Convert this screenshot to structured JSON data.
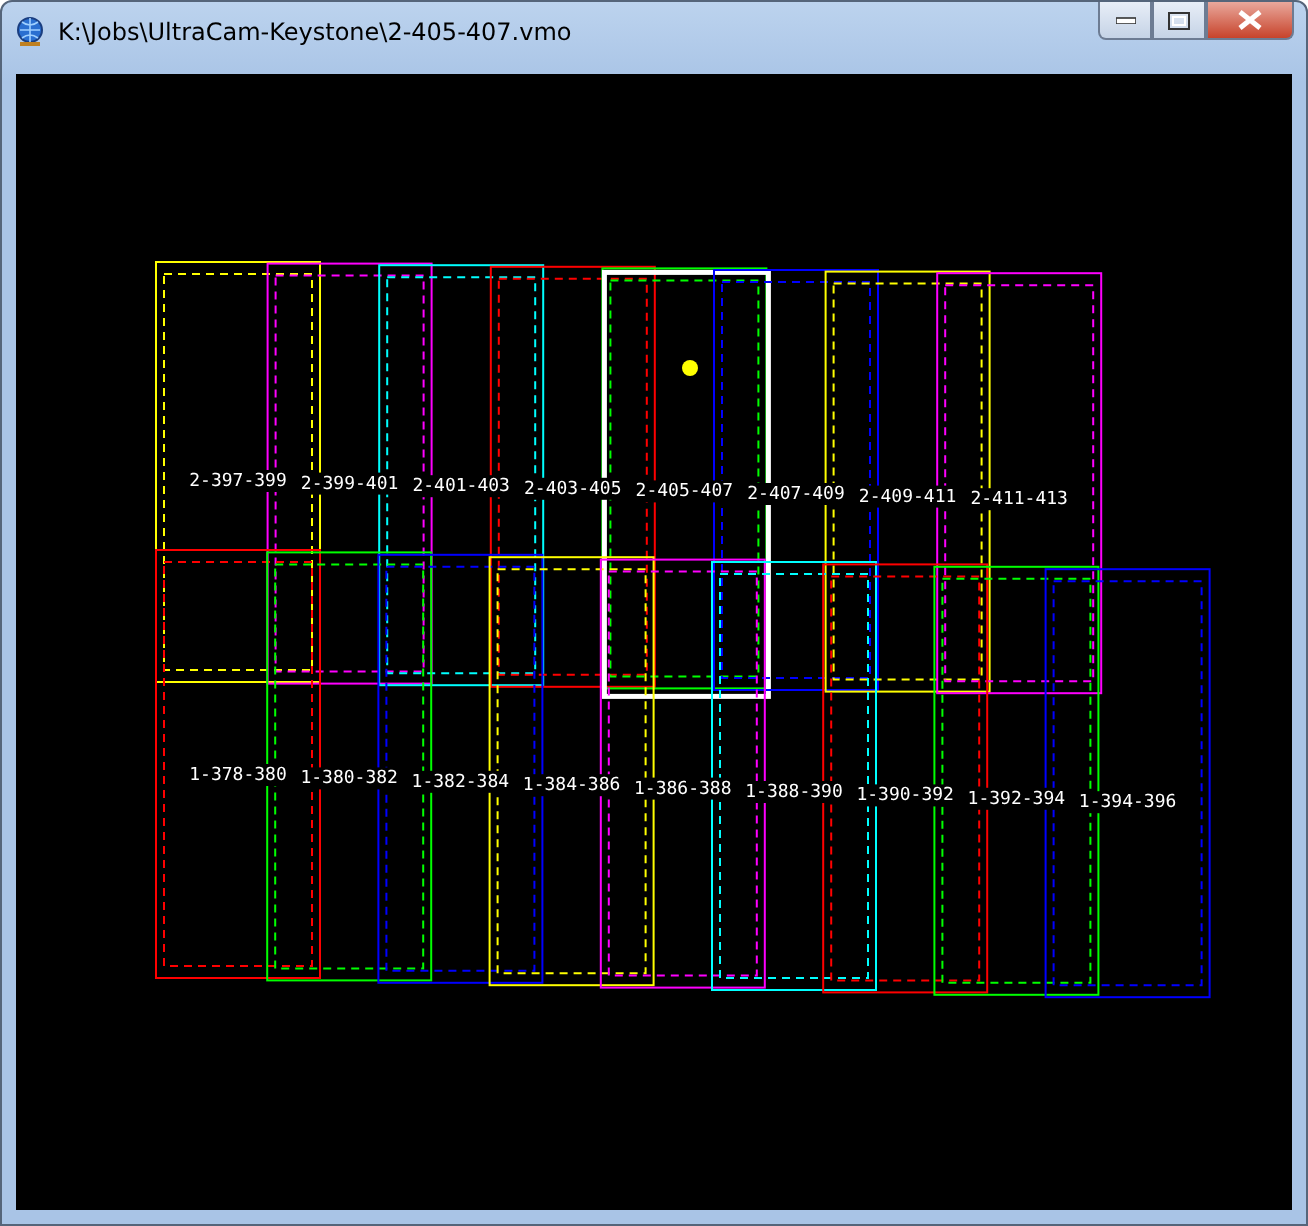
{
  "window": {
    "title": "K:\\Jobs\\UltraCam-Keystone\\2-405-407.vmo"
  },
  "strips": [
    {
      "frames": [
        {
          "label": "2-397-399",
          "color": "#ffff00",
          "selected": false
        },
        {
          "label": "2-399-401",
          "color": "#ff00ff",
          "selected": false
        },
        {
          "label": "2-401-403",
          "color": "#00ffff",
          "selected": false
        },
        {
          "label": "2-403-405",
          "color": "#ff0000",
          "selected": false
        },
        {
          "label": "2-405-407",
          "color": "#00ff00",
          "selected": true
        },
        {
          "label": "2-407-409",
          "color": "#0000ff",
          "selected": false
        },
        {
          "label": "2-409-411",
          "color": "#ffff00",
          "selected": false
        },
        {
          "label": "2-411-413",
          "color": "#ff00ff",
          "selected": false
        }
      ]
    },
    {
      "frames": [
        {
          "label": "1-378-380",
          "color": "#ff0000",
          "selected": false
        },
        {
          "label": "1-380-382",
          "color": "#00ff00",
          "selected": false
        },
        {
          "label": "1-382-384",
          "color": "#0000ff",
          "selected": false
        },
        {
          "label": "1-384-386",
          "color": "#ffff00",
          "selected": false
        },
        {
          "label": "1-386-388",
          "color": "#ff00ff",
          "selected": false
        },
        {
          "label": "1-388-390",
          "color": "#00ffff",
          "selected": false
        },
        {
          "label": "1-390-392",
          "color": "#ff0000",
          "selected": false
        },
        {
          "label": "1-392-394",
          "color": "#00ff00",
          "selected": false
        },
        {
          "label": "1-394-396",
          "color": "#0000ff",
          "selected": false
        }
      ]
    }
  ]
}
